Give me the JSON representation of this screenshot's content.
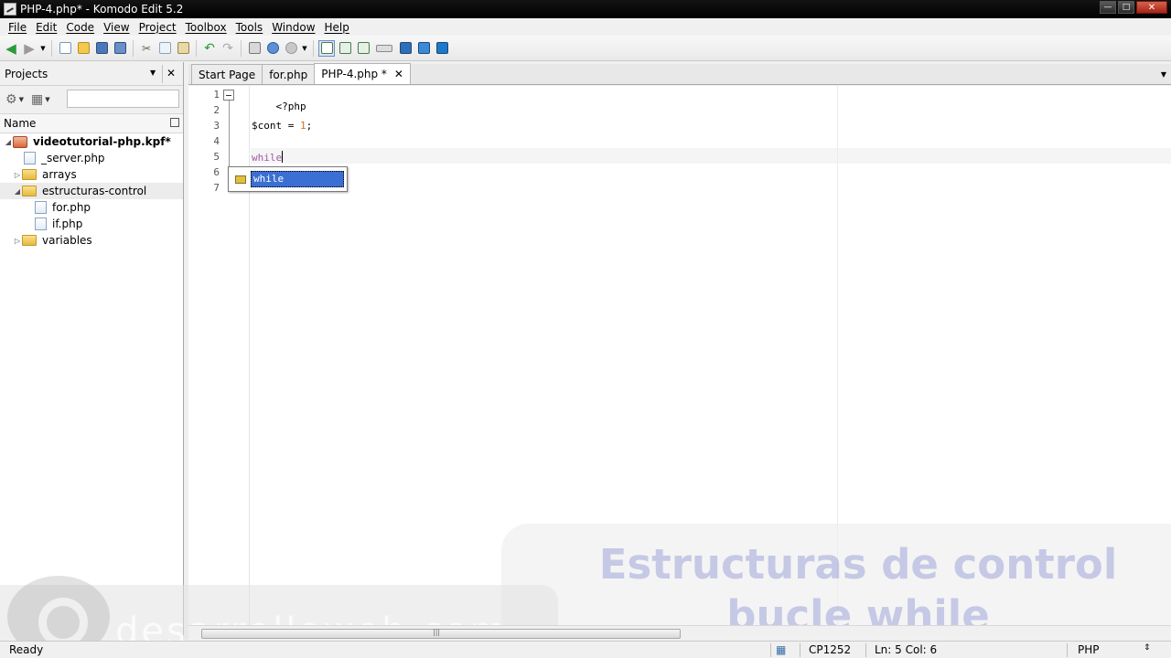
{
  "window": {
    "title": "PHP-4.php* - Komodo Edit 5.2"
  },
  "menu": [
    "File",
    "Edit",
    "Code",
    "View",
    "Project",
    "Toolbox",
    "Tools",
    "Window",
    "Help"
  ],
  "toolbar": {
    "icons": [
      "back-icon",
      "forward-icon",
      "new-file-icon",
      "open-folder-icon",
      "save-icon",
      "save-all-icon",
      "cut-icon",
      "copy-icon",
      "paste-icon",
      "undo-icon",
      "redo-icon",
      "print-icon",
      "preview-icon",
      "stop-icon",
      "left-pane-icon",
      "bottom-pane-icon",
      "right-pane-icon",
      "toolbar-toggle-icon",
      "email-icon",
      "browser-icon",
      "komodo-icon"
    ]
  },
  "projects_panel": {
    "title": "Projects",
    "column_header": "Name",
    "tree": [
      {
        "label": "videotutorial-php.kpf*",
        "type": "project",
        "level": 0,
        "expanded": true,
        "bold": true
      },
      {
        "label": "_server.php",
        "type": "file",
        "level": 1
      },
      {
        "label": "arrays",
        "type": "folder",
        "level": 1,
        "expanded": false
      },
      {
        "label": "estructuras-control",
        "type": "folder",
        "level": 1,
        "expanded": true,
        "selected": true
      },
      {
        "label": "for.php",
        "type": "file",
        "level": 2
      },
      {
        "label": "if.php",
        "type": "file",
        "level": 2
      },
      {
        "label": "variables",
        "type": "folder",
        "level": 1,
        "expanded": false
      }
    ]
  },
  "tabs": [
    {
      "label": "Start Page",
      "active": false
    },
    {
      "label": "for.php",
      "active": false
    },
    {
      "label": "PHP-4.php *",
      "active": true
    }
  ],
  "editor": {
    "line_numbers": [
      "1",
      "2",
      "3",
      "4",
      "5",
      "6",
      "7"
    ],
    "code": {
      "line1": "<?php",
      "line3_var": "$cont = ",
      "line3_num": "1",
      "line3_end": ";",
      "line5_kw": "while"
    },
    "autocomplete": {
      "item": "while"
    }
  },
  "overlay": {
    "title_line1": "Estructuras de control",
    "title_line2": "bucle while",
    "brand": "desarrolloweb.com"
  },
  "status": {
    "left": "Ready",
    "encoding": "CP1252",
    "position": "Ln: 5 Col: 6",
    "language": "PHP"
  }
}
